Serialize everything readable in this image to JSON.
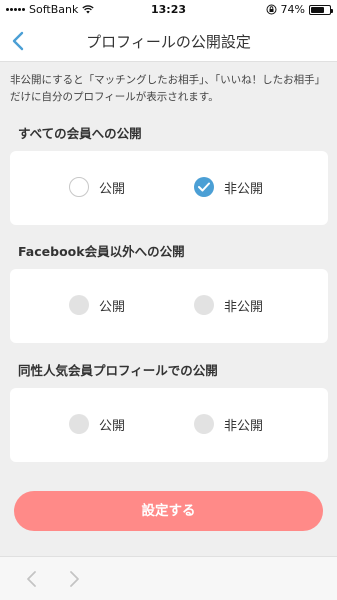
{
  "status_bar": {
    "carrier": "SoftBank",
    "time": "13:23",
    "battery": "74%",
    "battery_level": 0.74
  },
  "header": {
    "title": "プロフィールの公開設定",
    "back_icon": "chevron-left-icon"
  },
  "description": "非公開にすると「マッチングしたお相手」、「いいね！したお相手」だけに自分のプロフィールが表示されます。",
  "sections": [
    {
      "title": "すべての会員への公開",
      "options": [
        {
          "label": "公開",
          "state": "unchecked"
        },
        {
          "label": "非公開",
          "state": "checked"
        }
      ]
    },
    {
      "title": "Facebook会員以外への公開",
      "options": [
        {
          "label": "公開",
          "state": "disabled"
        },
        {
          "label": "非公開",
          "state": "disabled"
        }
      ]
    },
    {
      "title": "同性人気会員プロフィールでの公開",
      "options": [
        {
          "label": "公開",
          "state": "disabled"
        },
        {
          "label": "非公開",
          "state": "disabled"
        }
      ]
    }
  ],
  "submit_label": "設定する",
  "colors": {
    "accent": "#4b9fd5",
    "button": "#ff8a88",
    "background": "#efefef"
  },
  "bottom_nav": {
    "back_icon": "chevron-left-icon",
    "forward_icon": "chevron-right-icon"
  }
}
